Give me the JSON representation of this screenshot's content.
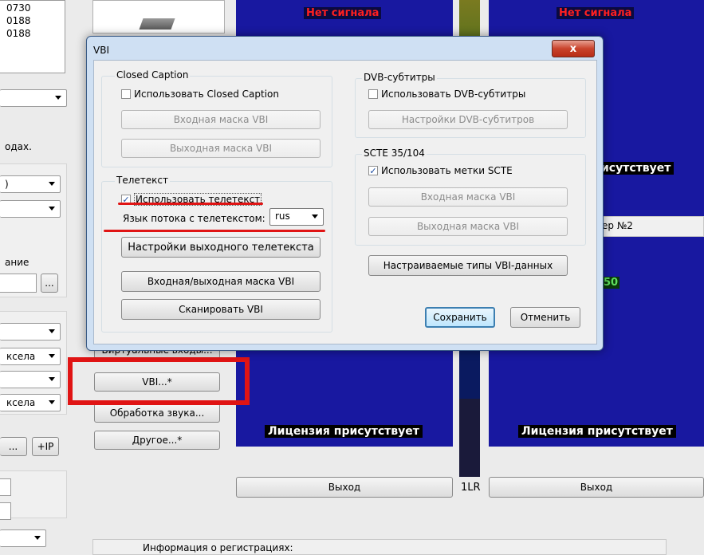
{
  "left_panel": {
    "list_values": [
      "0730",
      "0188",
      "0188"
    ],
    "text_fragment_1": "одах.",
    "text_fragment_2": "ание",
    "combo_values": [
      ")",
      "",
      "",
      "ксела",
      "",
      "ксела",
      ""
    ],
    "browse_btn": "...",
    "add_ip_btn": "+IP",
    "ip_ellipsis": "..."
  },
  "mid_panel": {
    "virtual_inputs": "Виртуальные входы...",
    "vbi_btn": "VBI...*",
    "audio_btn": "Обработка звука...",
    "other_btn": "Другое...*",
    "reg_info": "Информация о регистрациях:"
  },
  "video": {
    "no_signal": "Нет сигнала",
    "license_present": "Лицензия присутствует",
    "license_partial": "исутствует",
    "partial_number": "ер №2",
    "partial_value": "50",
    "exit_label": "Выход",
    "level_label": "1LR"
  },
  "dialog": {
    "title": "VBI",
    "close": "x",
    "closed_caption": {
      "group_label": "Closed Caption",
      "checkbox_label": "Использовать Closed Caption",
      "checked": false,
      "input_mask": "Входная маска VBI",
      "output_mask": "Выходная маска VBI"
    },
    "teletext": {
      "group_label": "Телетекст",
      "checkbox_label": "Использовать телетекст",
      "checked": true,
      "lang_label": "Язык потока с телетекстом:",
      "lang_value": "rus",
      "output_settings": "Настройки выходного телетекста",
      "io_mask": "Входная/выходная маска VBI",
      "scan": "Сканировать VBI"
    },
    "dvb": {
      "group_label": "DVB-субтитры",
      "checkbox_label": "Использовать DVB-субтитры",
      "checked": false,
      "settings": "Настройки DVB-субтитров"
    },
    "scte": {
      "group_label": "SCTE 35/104",
      "checkbox_label": "Использовать метки SCTE",
      "checked": true,
      "input_mask": "Входная маска VBI",
      "output_mask": "Выходная маска VBI"
    },
    "custom_types": "Настраиваемые типы VBI-данных",
    "save": "Сохранить",
    "cancel": "Отменить"
  },
  "colors": {
    "annotation_red": "#e01414",
    "video_blue": "#1818a0",
    "level_green": "#4c8a1a"
  }
}
